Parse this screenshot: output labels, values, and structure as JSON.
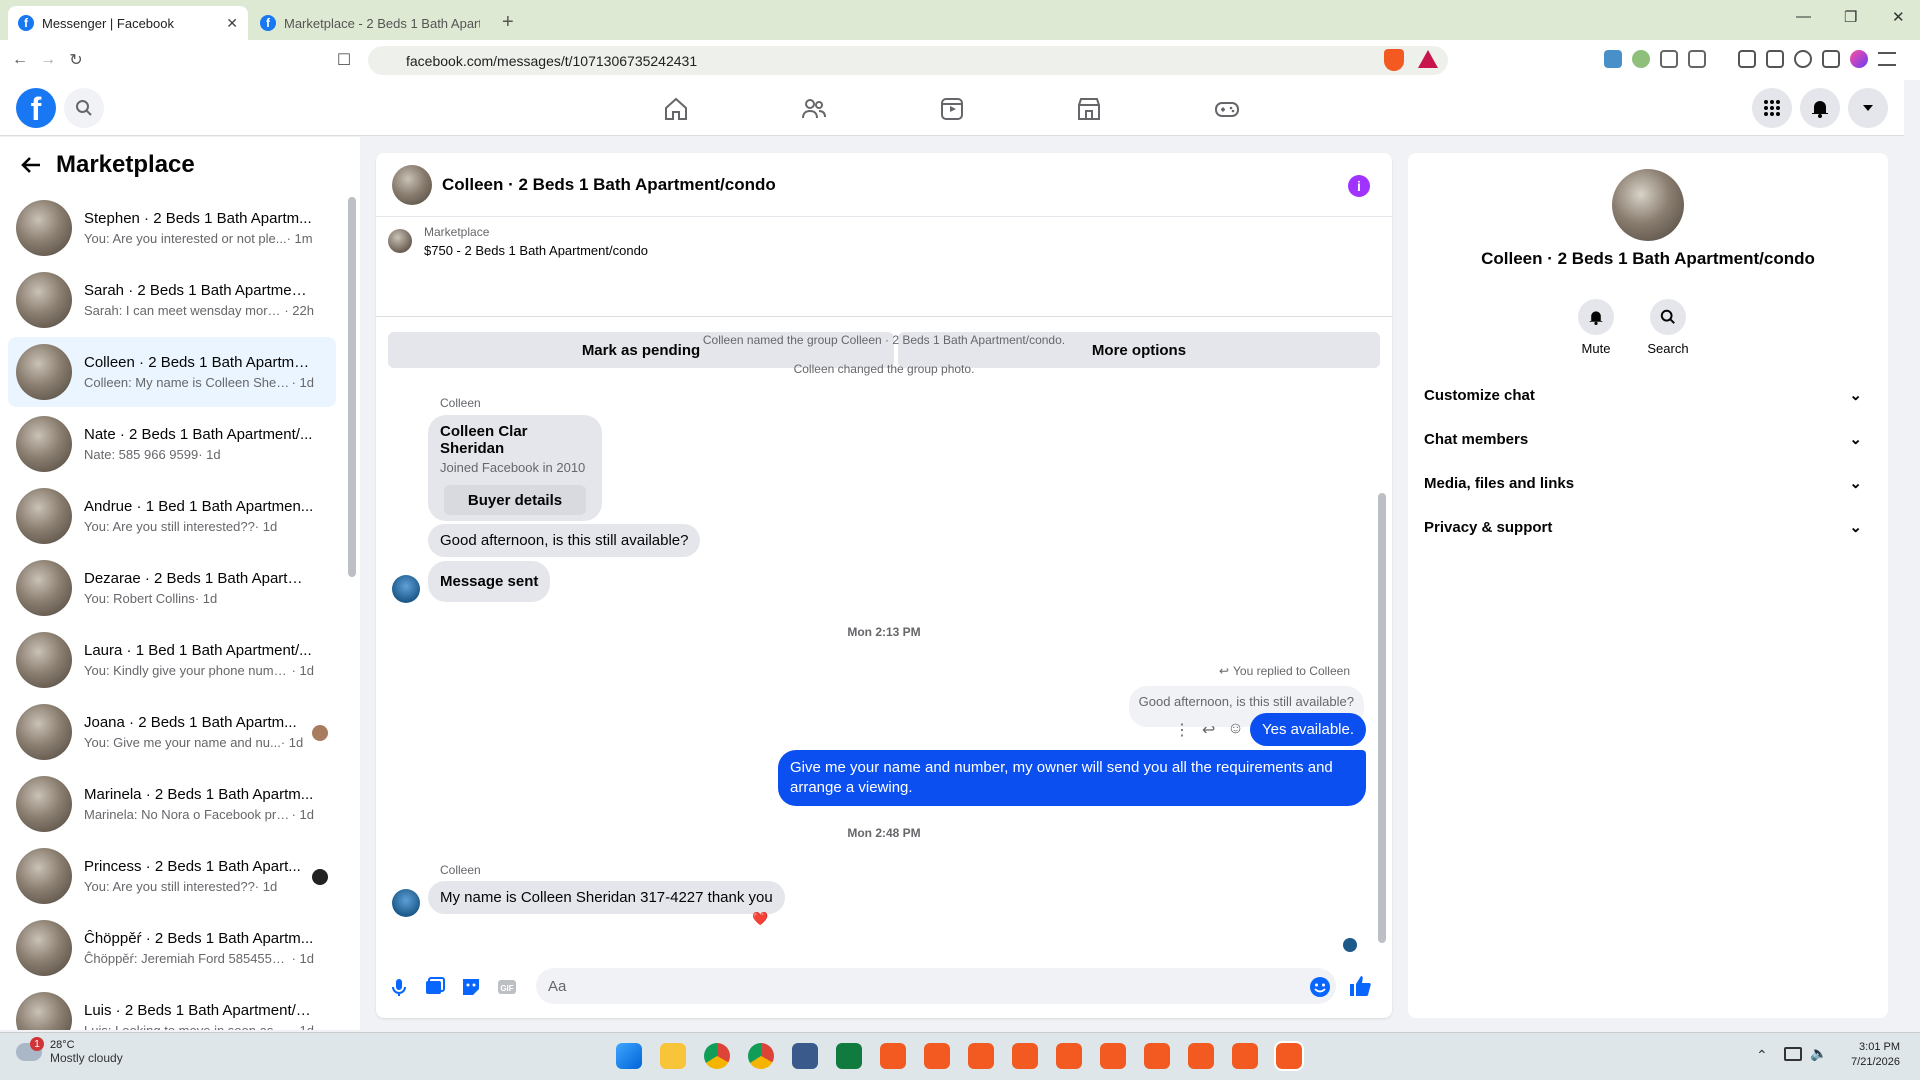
{
  "browser": {
    "tabs": [
      {
        "title": "Messenger | Facebook",
        "active": true
      },
      {
        "title": "Marketplace - 2 Beds 1 Bath Apartme",
        "active": false
      }
    ],
    "url": "facebook.com/messages/t/1071306735242431"
  },
  "sidebar": {
    "title": "Marketplace",
    "conversations": [
      {
        "name": "Stephen · 2 Beds 1 Bath Apartm...",
        "snippet": "You: Are you interested or not ple...",
        "time": " · 1m"
      },
      {
        "name": "Sarah · 2 Beds 1 Bath Apartment...",
        "snippet": "Sarah: I can meet wensday morni...",
        "time": " · 22h"
      },
      {
        "name": "Colleen · 2 Beds 1 Bath Apartme...",
        "snippet": "Colleen: My name is Colleen Sherid...",
        "time": " · 1d",
        "active": true
      },
      {
        "name": "Nate · 2 Beds 1 Bath Apartment/...",
        "snippet": "Nate: 585 966 9599",
        "time": " · 1d"
      },
      {
        "name": "Andrue · 1 Bed 1 Bath Apartmen...",
        "snippet": "You: Are you still interested??",
        "time": " · 1d"
      },
      {
        "name": "Dezarae · 2 Beds 1 Bath Apartme...",
        "snippet": "You: Robert Collins",
        "time": " · 1d"
      },
      {
        "name": "Laura · 1 Bed 1 Bath Apartment/...",
        "snippet": "You: Kindly give your phone numbe...",
        "time": " · 1d"
      },
      {
        "name": "Joana · 2 Beds 1 Bath Apartm...",
        "snippet": "You: Give me your name and nu...",
        "time": " · 1d",
        "seen": "#a87c5f"
      },
      {
        "name": "Marinela · 2 Beds 1 Bath Apartm...",
        "snippet": "Marinela: No Nora o Facebook pro...",
        "time": " · 1d"
      },
      {
        "name": "Princess · 2 Beds 1 Bath Apart...",
        "snippet": "You: Are you still interested??",
        "time": " · 1d",
        "seen": "#222222"
      },
      {
        "name": "Ĉhöppěŕ · 2 Beds 1 Bath Apartm...",
        "snippet": "Ĉhöppěŕ: Jeremiah Ford 5854553779",
        "time": " · 1d"
      },
      {
        "name": "Luis · 2 Beds 1 Bath Apartment/c...",
        "snippet": "Luis: Looking to move in soon as p...",
        "time": " · 1d"
      }
    ]
  },
  "chat": {
    "title": "Colleen · 2 Beds 1 Bath Apartment/condo",
    "marketplace_label": "Marketplace",
    "listing": "$750 - 2 Beds 1 Bath Apartment/condo",
    "mark_pending": "Mark as pending",
    "more_options": "More options",
    "sys1": "Colleen named the group Colleen · 2 Beds 1 Bath Apartment/condo.",
    "sys2": "Colleen changed the group photo.",
    "sender1": "Colleen",
    "card_name": "Colleen Clar Sheridan",
    "card_sub": "Joined Facebook in 2010",
    "buyer_details": "Buyer details",
    "msg1": "Good afternoon, is this still available?",
    "msg2": "Message sent",
    "ts1": "Mon 2:13 PM",
    "replied": "You replied to Colleen",
    "quoted": "Good afternoon, is this still available?",
    "me1": "Yes available.",
    "me2": "Give me your name and number, my owner will send you all the requirements and arrange a viewing.",
    "ts2": "Mon 2:48 PM",
    "sender2": "Colleen",
    "msg3": "My name is Colleen Sheridan 317-4227 thank you",
    "reaction": "❤️",
    "composer_placeholder": "Aa"
  },
  "info": {
    "name": "Colleen · 2 Beds 1 Bath Apartment/condo",
    "mute": "Mute",
    "search": "Search",
    "sections": [
      "Customize chat",
      "Chat members",
      "Media, files and links",
      "Privacy & support"
    ]
  },
  "taskbar": {
    "temp": "28°C",
    "weather": "Mostly cloudy",
    "badge": "1",
    "time": "3:01 PM",
    "date": "7/21/2026"
  },
  "colors": {
    "fb_blue": "#1877f2",
    "my_bubble": "#0b4ff0",
    "info_purple": "#a033ff"
  }
}
